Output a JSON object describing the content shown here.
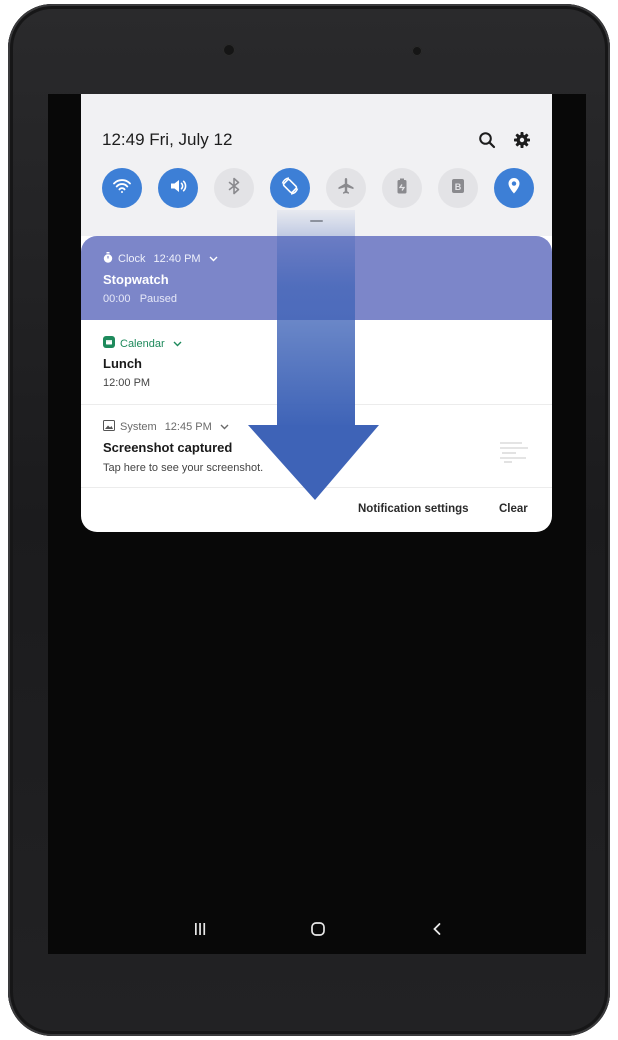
{
  "status": {
    "time_date": "12:49  Fri, July 12"
  },
  "header_icons": {
    "search": "search-icon",
    "settings": "gear-icon"
  },
  "quick_settings": [
    {
      "name": "wifi-icon",
      "state": "on"
    },
    {
      "name": "sound-icon",
      "state": "on"
    },
    {
      "name": "bluetooth-icon",
      "state": "off"
    },
    {
      "name": "auto-rotate-icon",
      "state": "on"
    },
    {
      "name": "airplane-mode-icon",
      "state": "off"
    },
    {
      "name": "power-saving-icon",
      "state": "off"
    },
    {
      "name": "blue-light-filter-icon",
      "state": "off"
    },
    {
      "name": "location-icon",
      "state": "on"
    }
  ],
  "notifications": {
    "clock": {
      "app": "Clock",
      "time": "12:40 PM",
      "title": "Stopwatch",
      "body": "00:00   Paused"
    },
    "calendar": {
      "app": "Calendar",
      "title": "Lunch",
      "body": "12:00 PM"
    },
    "system": {
      "app": "System",
      "time": "12:45 PM",
      "title": "Screenshot captured",
      "body": "Tap here to see your screenshot."
    }
  },
  "footer": {
    "settings_label": "Notification settings",
    "clear_label": "Clear"
  },
  "nav": {
    "recents": "recents-icon",
    "home": "home-icon",
    "back": "back-icon"
  },
  "colors": {
    "accent": "#3d7fd6",
    "clock_bg": "#7c86c9",
    "calendar": "#1e8a5c",
    "arrow": "#3e63b7"
  }
}
